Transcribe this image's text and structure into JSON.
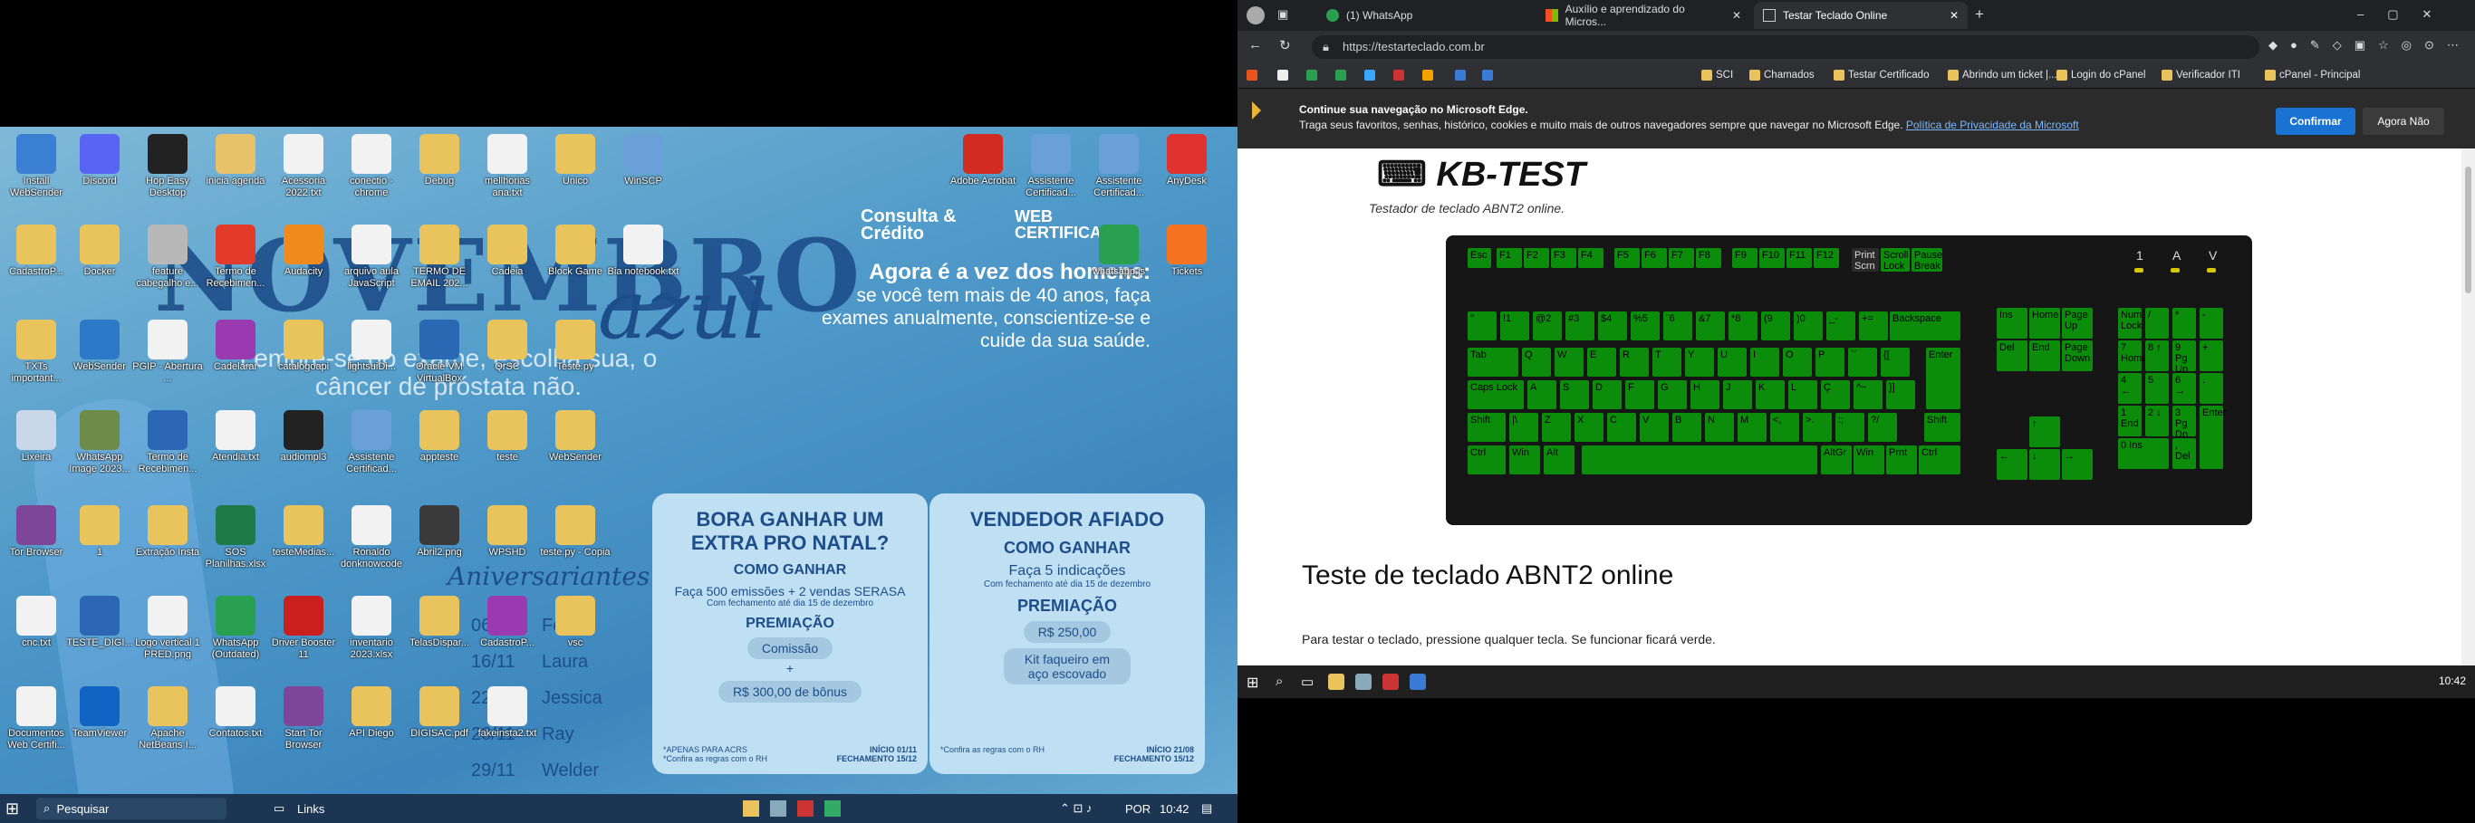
{
  "left_desktop": {
    "poster": {
      "title": "NOVEMBRO",
      "title_script": "azul",
      "lembre": "Lembre-se do exame, escolha sua, o câncer de próstata não.",
      "agora_title": "Agora é a vez dos homens:",
      "agora_text": "se você tem mais de 40 anos, faça exames anualmente, conscientize-se e cuide da sua saúde.",
      "logo1": "Consulta & Crédito",
      "logo2": "WEB CERTIFICADOS",
      "aniversariantes": "Aniversariantes",
      "birthdays": [
        {
          "date": "06/11",
          "name": "Fe"
        },
        {
          "date": "16/11",
          "name": "Laura"
        },
        {
          "date": "22/11",
          "name": "Jessica"
        },
        {
          "date": "28/11",
          "name": "Ray"
        },
        {
          "date": "29/11",
          "name": "Welder"
        }
      ],
      "card1": {
        "title": "BORA GANHAR UM EXTRA PRO NATAL?",
        "como": "COMO GANHAR",
        "desc": "Faça 500 emissões + 2 vendas SERASA",
        "sub": "Com fechamento até dia 15 de dezembro",
        "premiacao": "PREMIAÇÃO",
        "p1": "Comissão",
        "plus": "+",
        "p2": "R$ 300,00 de bônus",
        "foot_l": "*APENAS PARA ACRS *Confira as regras com o RH",
        "foot_r": "INÍCIO 01/11 FECHAMENTO 15/12"
      },
      "card2": {
        "title": "VENDEDOR AFIADO",
        "como": "COMO GANHAR",
        "desc": "Faça 5 indicações",
        "sub": "Com fechamento até dia 15 de dezembro",
        "premiacao": "PREMIAÇÃO",
        "p1": "R$ 250,00",
        "p2": "Kit faqueiro em aço escovado",
        "foot_l": "*Confira as regras com o RH",
        "foot_r": "INÍCIO 21/08 FECHAMENTO 15/12"
      }
    },
    "icons": [
      {
        "label": "Install WebSender",
        "color": "#3b7fd3"
      },
      {
        "label": "Discord",
        "color": "#5865f2"
      },
      {
        "label": "Hop Easy Desktop",
        "color": "#222"
      },
      {
        "label": "inicia agenda",
        "color": "#e7c26b"
      },
      {
        "label": "Acessoria 2022.txt",
        "color": "#f2f2f2"
      },
      {
        "label": "conectio - chrome",
        "color": "#f2f2f2"
      },
      {
        "label": "Debug",
        "color": "#e9c35b"
      },
      {
        "label": "mellhorias ana.txt",
        "color": "#f2f2f2"
      },
      {
        "label": "Unico",
        "color": "#e9c35b"
      },
      {
        "label": "WinSCP",
        "color": "#6aa0d8"
      },
      {
        "label": "CadastroP...",
        "color": "#e9c35b"
      },
      {
        "label": "Docker",
        "color": "#e9c35b"
      },
      {
        "label": "feature cabegalho e...",
        "color": "#b8b8b8"
      },
      {
        "label": "Termo de Recebimen...",
        "color": "#e23b2b"
      },
      {
        "label": "Audacity",
        "color": "#f08a1c"
      },
      {
        "label": "arquivo aula JavaScript",
        "color": "#f2f2f2"
      },
      {
        "label": "TERMO DE EMAIL 202...",
        "color": "#e9c35b"
      },
      {
        "label": "Cadeia",
        "color": "#e9c35b"
      },
      {
        "label": "Block Game",
        "color": "#e9c35b"
      },
      {
        "label": "Bia notebook.txt",
        "color": "#f2f2f2"
      },
      {
        "label": "TXTs important...",
        "color": "#e9c35b"
      },
      {
        "label": "WebSender",
        "color": "#2c7ac7"
      },
      {
        "label": "PGIP - Abertura ...",
        "color": "#f2f2f2"
      },
      {
        "label": "Cadelarar",
        "color": "#9a3ab0"
      },
      {
        "label": "catalogoapi",
        "color": "#e9c35b"
      },
      {
        "label": "lightsuiDi...",
        "color": "#f2f2f2"
      },
      {
        "label": "Oracle VM VirtualBox",
        "color": "#2a68b3"
      },
      {
        "label": "QrSC",
        "color": "#e9c35b"
      },
      {
        "label": "Teste.py",
        "color": "#e9c35b"
      },
      {
        "label": "Lixeira",
        "color": "#c8d8e8"
      },
      {
        "label": "WhatsApp Image 2023...",
        "color": "#6e8b4a"
      },
      {
        "label": "Termo de Recebimen...",
        "color": "#2d66b5"
      },
      {
        "label": "Atendia.txt",
        "color": "#f2f2f2"
      },
      {
        "label": "audiompl3",
        "color": "#222"
      },
      {
        "label": "Assistente Certificad...",
        "color": "#6aa0d8"
      },
      {
        "label": "appteste",
        "color": "#e9c35b"
      },
      {
        "label": "teste",
        "color": "#e9c35b"
      },
      {
        "label": "WebSender",
        "color": "#e9c35b"
      },
      {
        "label": "Tor Browser",
        "color": "#7d4698"
      },
      {
        "label": "1",
        "color": "#e9c35b"
      },
      {
        "label": "Extração Insta",
        "color": "#e9c35b"
      },
      {
        "label": "SOS Planilhas.xlsx",
        "color": "#1f7b45"
      },
      {
        "label": "testeMedias...",
        "color": "#e9c35b"
      },
      {
        "label": "Ronaldo donknowcode",
        "color": "#f2f2f2"
      },
      {
        "label": "Abril2.png",
        "color": "#3a3a3a"
      },
      {
        "label": "WPSHD",
        "color": "#e9c35b"
      },
      {
        "label": "teste.py - Copia",
        "color": "#e9c35b"
      },
      {
        "label": "cnc.txt",
        "color": "#f2f2f2"
      },
      {
        "label": "TESTE_DIGI...",
        "color": "#2d66b5"
      },
      {
        "label": "Logo vertical 1 PRED.png",
        "color": "#f2f2f2"
      },
      {
        "label": "WhatsApp (Outdated)",
        "color": "#29a04f"
      },
      {
        "label": "Driver Booster 11",
        "color": "#c9201d"
      },
      {
        "label": "inventario 2023.xlsx",
        "color": "#f2f2f2"
      },
      {
        "label": "TelasDispar...",
        "color": "#e9c35b"
      },
      {
        "label": "CadastroP...",
        "color": "#9a3ab0"
      },
      {
        "label": "vsc",
        "color": "#e9c35b"
      },
      {
        "label": "Documentos Web Certifi...",
        "color": "#f2f2f2"
      },
      {
        "label": "TeamViewer",
        "color": "#1264c4"
      },
      {
        "label": "Apache NetBeans I...",
        "color": "#e9c35b"
      },
      {
        "label": "Contatos.txt",
        "color": "#f2f2f2"
      },
      {
        "label": "Start Tor Browser",
        "color": "#7d4698"
      },
      {
        "label": "API Diego",
        "color": "#e9c35b"
      },
      {
        "label": "DIGISAC.pdf",
        "color": "#e9c35b"
      },
      {
        "label": "fakeinsta2.txt",
        "color": "#f2f2f2"
      },
      {
        "label": "Adobe Acrobat",
        "color": "#d22b1f"
      },
      {
        "label": "Assistente Certificad...",
        "color": "#6aa0d8"
      },
      {
        "label": "Assistente Certificad...",
        "color": "#6aa0d8"
      },
      {
        "label": "AnyDesk",
        "color": "#e0322e"
      },
      {
        "label": "whatsapp.js",
        "color": "#29a04f"
      },
      {
        "label": "Tickets",
        "color": "#f47421"
      }
    ],
    "taskbar": {
      "search": "Pesquisar",
      "links": "Links",
      "lang": "POR",
      "time": "10:42"
    }
  },
  "browser": {
    "tabs": [
      {
        "title": "(1) WhatsApp"
      },
      {
        "title": "Auxílio e aprendizado do Micros..."
      },
      {
        "title": "Testar Teclado Online"
      }
    ],
    "url": "https://testarteclado.com.br",
    "favorites": [
      "SCI",
      "Chamados",
      "Testar Certificado",
      "Abrindo um ticket |...",
      "Login do cPanel",
      "Verificador ITI",
      "cPanel - Principal"
    ],
    "infobar": {
      "title": "Continue sua navegação no Microsoft Edge.",
      "text": "Traga seus favoritos, senhas, histórico, cookies e muito mais de outros navegadores sempre que navegar no Microsoft Edge.",
      "link": "Política de Privacidade da Microsoft",
      "confirm": "Confirmar",
      "deny": "Agora Não"
    },
    "page": {
      "logo": "KB-TEST",
      "tagline": "Testador de teclado ABNT2 online.",
      "heading": "Teste de teclado ABNT2 online",
      "instructions": "Para testar o teclado, pressione qualquer tecla. Se funcionar ficará verde.",
      "leds": [
        "1",
        "A",
        "V"
      ]
    }
  },
  "right_taskbar": {
    "time": "10:42"
  }
}
